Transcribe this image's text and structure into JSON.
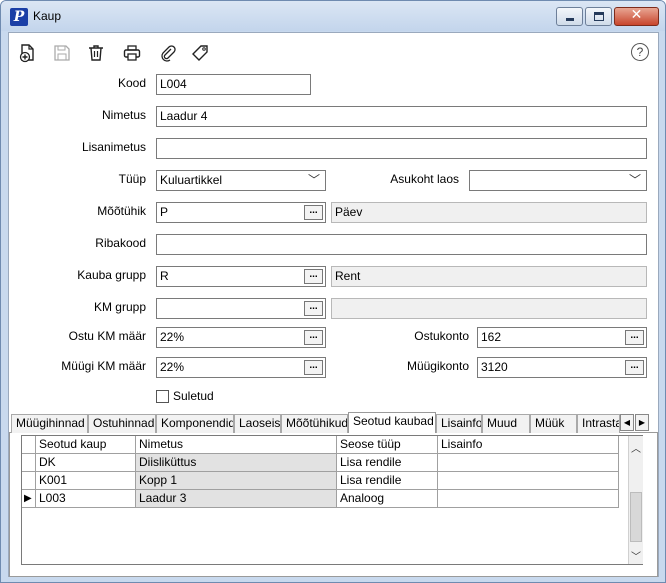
{
  "window": {
    "title": "Kaup",
    "app_icon": "P"
  },
  "toolbar": {
    "icons": [
      "new-document-icon",
      "save-icon",
      "trash-icon",
      "print-icon",
      "attach-icon",
      "tag-icon",
      "help-icon"
    ],
    "help_glyph": "?"
  },
  "form": {
    "kood": {
      "label": "Kood",
      "value": "L004"
    },
    "nimetus": {
      "label": "Nimetus",
      "value": "Laadur 4"
    },
    "lisanimetus": {
      "label": "Lisanimetus",
      "value": ""
    },
    "tyyp": {
      "label": "Tüüp",
      "value": "Kuluartikkel"
    },
    "asukoht": {
      "label": "Asukoht laos",
      "value": ""
    },
    "mootyhik": {
      "label": "Mõõtühik",
      "value": "P",
      "desc": "Päev"
    },
    "ribakood": {
      "label": "Ribakood",
      "value": ""
    },
    "kauba_grupp": {
      "label": "Kauba grupp",
      "value": "R",
      "desc": "Rent"
    },
    "km_grupp": {
      "label": "KM grupp",
      "value": "",
      "desc": ""
    },
    "ostu_km": {
      "label": "Ostu KM määr",
      "value": "22%"
    },
    "ostukonto": {
      "label": "Ostukonto",
      "value": "162"
    },
    "myygi_km": {
      "label": "Müügi KM määr",
      "value": "22%"
    },
    "myygikonto": {
      "label": "Müügikonto",
      "value": "3120"
    },
    "suletud": {
      "label": "Suletud",
      "checked": false
    },
    "dots": "..."
  },
  "tabs": [
    "Müügihinnad",
    "Ostuhinnad",
    "Komponendid",
    "Laoseis",
    "Mõõtühikud",
    "Seotud kaubad",
    "Lisainfo",
    "Muud",
    "Müük",
    "Intrastat"
  ],
  "active_tab": "Seotud kaubad",
  "grid": {
    "columns": [
      "Seotud kaup",
      "Nimetus",
      "Seose tüüp",
      "Lisainfo"
    ],
    "rows": [
      {
        "kaup": "DK",
        "nimetus": "Diisliküttus",
        "tyyp": "Lisa rendile",
        "info": ""
      },
      {
        "kaup": "K001",
        "nimetus": "Kopp 1",
        "tyyp": "Lisa rendile",
        "info": ""
      },
      {
        "kaup": "L003",
        "nimetus": "Laadur 3",
        "tyyp": "Analoog",
        "info": ""
      }
    ]
  }
}
